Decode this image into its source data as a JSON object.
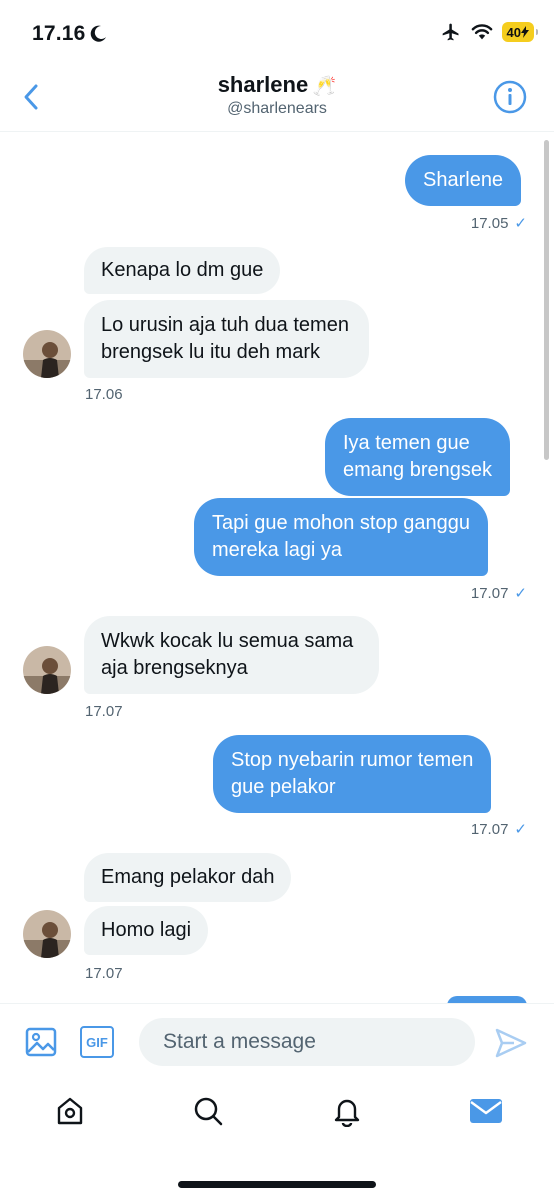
{
  "status": {
    "time": "17.16",
    "battery": "40"
  },
  "header": {
    "name": "sharlene",
    "emoji": "🥂",
    "handle": "@sharlenears"
  },
  "messages": {
    "m1": "Sharlene",
    "t1": "17.05",
    "m2": "Kenapa lo dm gue",
    "m3_l1": "Lo urusin aja tuh dua temen",
    "m3_l2": "brengsek lu itu deh mark",
    "t2": "17.06",
    "m4_l1": "Iya temen gue",
    "m4_l2": "emang brengsek",
    "m5_l1": "Tapi gue mohon stop ganggu",
    "m5_l2": "mereka lagi ya",
    "t3": "17.07",
    "m6_l1": "Wkwk kocak lu semua sama",
    "m6_l2": "aja brengseknya",
    "t4": "17.07",
    "m7_l1": "Stop nyebarin rumor temen",
    "m7_l2": "gue pelakor",
    "t5": "17.07",
    "m8": "Emang pelakor dah",
    "m9": "Homo lagi",
    "t6": "17.07"
  },
  "composer": {
    "placeholder": "Start a message",
    "gif_label": "GIF"
  },
  "icons": {
    "back": "chevron-left-icon",
    "info": "info-icon",
    "image": "image-icon",
    "send": "send-icon",
    "home": "home-icon",
    "search": "search-icon",
    "notifications": "bell-icon",
    "messages": "mail-icon"
  },
  "colors": {
    "accent": "#4a98e7",
    "received_bubble": "#eff3f4",
    "secondary_text": "#536471"
  }
}
